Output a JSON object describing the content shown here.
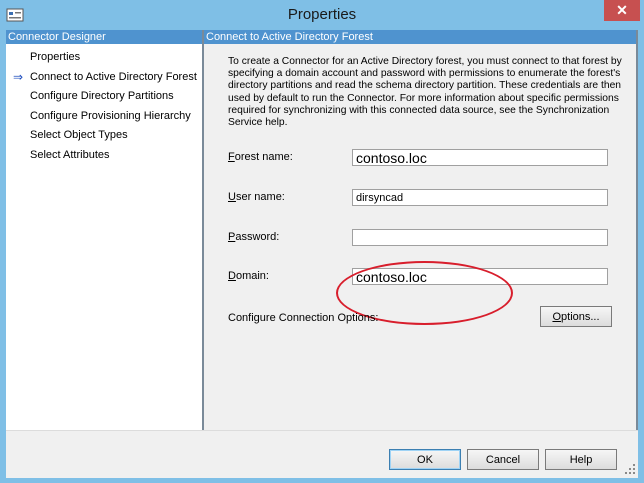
{
  "window": {
    "title": "Properties",
    "close_glyph": "✕"
  },
  "nav": {
    "header": "Connector Designer",
    "items": [
      {
        "label": "Properties",
        "selected": false
      },
      {
        "label": "Connect to Active Directory Forest",
        "selected": true,
        "marker_icon": "arrow-right-icon",
        "marker_glyph": "⇒"
      },
      {
        "label": "Configure Directory Partitions",
        "selected": false
      },
      {
        "label": "Configure Provisioning Hierarchy",
        "selected": false
      },
      {
        "label": "Select Object Types",
        "selected": false
      },
      {
        "label": "Select Attributes",
        "selected": false
      }
    ]
  },
  "content": {
    "header": "Connect to Active Directory Forest",
    "description": "To create a Connector for an Active Directory forest, you must connect to that forest by specifying a domain account and password with permissions to enumerate the forest's directory partitions and read the schema directory partition. These credentials are then used by default to run the Connector. For more information about specific permissions required for synchronizing with this connected data source, see the Synchronization Service help.",
    "fields": {
      "forest": {
        "mnemonic": "F",
        "rest": "orest name:",
        "value": "contoso.loc"
      },
      "user": {
        "mnemonic": "U",
        "rest": "ser name:",
        "value": "dirsyncad"
      },
      "password": {
        "mnemonic": "P",
        "rest": "assword:",
        "value": ""
      },
      "domain": {
        "mnemonic": "D",
        "rest": "omain:",
        "value": "contoso.loc"
      }
    },
    "connection_options_label": "Configure Connection Options:",
    "options_button": {
      "mnemonic": "O",
      "rest": "ptions..."
    }
  },
  "buttons": {
    "ok": "OK",
    "cancel": "Cancel",
    "help": "Help"
  },
  "colors": {
    "title_bar": "#7fbfe6",
    "panel_header": "#4f93cf",
    "close_button": "#c75050",
    "annotation_ellipse": "#d81e2c"
  }
}
